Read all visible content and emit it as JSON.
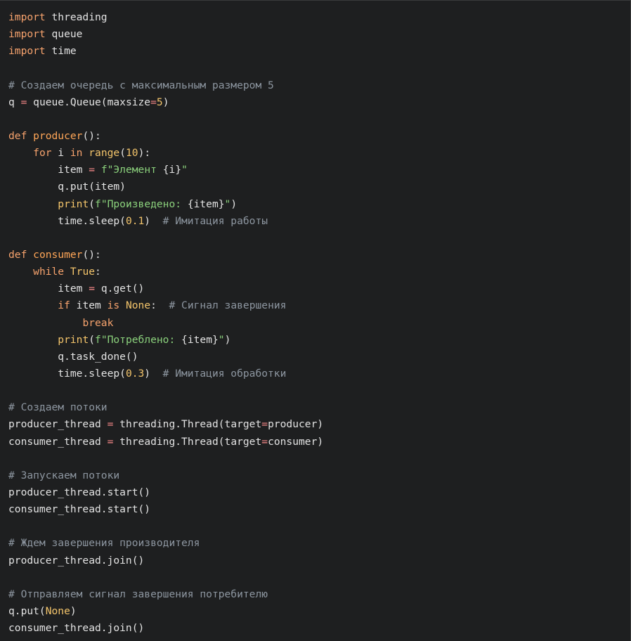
{
  "code": {
    "language": "python",
    "lines": [
      [
        {
          "t": "import",
          "c": "kw"
        },
        {
          "t": " threading",
          "c": "tx"
        }
      ],
      [
        {
          "t": "import",
          "c": "kw"
        },
        {
          "t": " queue",
          "c": "tx"
        }
      ],
      [
        {
          "t": "import",
          "c": "kw"
        },
        {
          "t": " time",
          "c": "tx"
        }
      ],
      [],
      [
        {
          "t": "# Создаем очередь с максимальным размером 5",
          "c": "cm"
        }
      ],
      [
        {
          "t": "q ",
          "c": "tx"
        },
        {
          "t": "=",
          "c": "op"
        },
        {
          "t": " queue.Queue(maxsize",
          "c": "tx"
        },
        {
          "t": "=",
          "c": "op"
        },
        {
          "t": "5",
          "c": "num"
        },
        {
          "t": ")",
          "c": "tx"
        }
      ],
      [],
      [
        {
          "t": "def",
          "c": "kw"
        },
        {
          "t": " ",
          "c": "tx"
        },
        {
          "t": "producer",
          "c": "fn"
        },
        {
          "t": "():",
          "c": "tx"
        }
      ],
      [
        {
          "t": "    ",
          "c": "tx"
        },
        {
          "t": "for",
          "c": "kw"
        },
        {
          "t": " i ",
          "c": "tx"
        },
        {
          "t": "in",
          "c": "kw"
        },
        {
          "t": " ",
          "c": "tx"
        },
        {
          "t": "range",
          "c": "bi"
        },
        {
          "t": "(",
          "c": "tx"
        },
        {
          "t": "10",
          "c": "num"
        },
        {
          "t": "):",
          "c": "tx"
        }
      ],
      [
        {
          "t": "        item ",
          "c": "tx"
        },
        {
          "t": "=",
          "c": "op"
        },
        {
          "t": " ",
          "c": "tx"
        },
        {
          "t": "f\"Элемент ",
          "c": "st"
        },
        {
          "t": "{i}",
          "c": "tx"
        },
        {
          "t": "\"",
          "c": "st"
        }
      ],
      [
        {
          "t": "        q.put(item)",
          "c": "tx"
        }
      ],
      [
        {
          "t": "        ",
          "c": "tx"
        },
        {
          "t": "print",
          "c": "bi"
        },
        {
          "t": "(",
          "c": "tx"
        },
        {
          "t": "f\"Произведено: ",
          "c": "st"
        },
        {
          "t": "{item}",
          "c": "tx"
        },
        {
          "t": "\"",
          "c": "st"
        },
        {
          "t": ")",
          "c": "tx"
        }
      ],
      [
        {
          "t": "        time.sleep(",
          "c": "tx"
        },
        {
          "t": "0.1",
          "c": "num"
        },
        {
          "t": ")  ",
          "c": "tx"
        },
        {
          "t": "# Имитация работы",
          "c": "cm"
        }
      ],
      [],
      [
        {
          "t": "def",
          "c": "kw"
        },
        {
          "t": " ",
          "c": "tx"
        },
        {
          "t": "consumer",
          "c": "fn"
        },
        {
          "t": "():",
          "c": "tx"
        }
      ],
      [
        {
          "t": "    ",
          "c": "tx"
        },
        {
          "t": "while",
          "c": "kw"
        },
        {
          "t": " ",
          "c": "tx"
        },
        {
          "t": "True",
          "c": "bi"
        },
        {
          "t": ":",
          "c": "tx"
        }
      ],
      [
        {
          "t": "        item ",
          "c": "tx"
        },
        {
          "t": "=",
          "c": "op"
        },
        {
          "t": " q.get()",
          "c": "tx"
        }
      ],
      [
        {
          "t": "        ",
          "c": "tx"
        },
        {
          "t": "if",
          "c": "kw"
        },
        {
          "t": " item ",
          "c": "tx"
        },
        {
          "t": "is",
          "c": "kw"
        },
        {
          "t": " ",
          "c": "tx"
        },
        {
          "t": "None",
          "c": "bi"
        },
        {
          "t": ":  ",
          "c": "tx"
        },
        {
          "t": "# Сигнал завершения",
          "c": "cm"
        }
      ],
      [
        {
          "t": "            ",
          "c": "tx"
        },
        {
          "t": "break",
          "c": "kw"
        }
      ],
      [
        {
          "t": "        ",
          "c": "tx"
        },
        {
          "t": "print",
          "c": "bi"
        },
        {
          "t": "(",
          "c": "tx"
        },
        {
          "t": "f\"Потреблено: ",
          "c": "st"
        },
        {
          "t": "{item}",
          "c": "tx"
        },
        {
          "t": "\"",
          "c": "st"
        },
        {
          "t": ")",
          "c": "tx"
        }
      ],
      [
        {
          "t": "        q.task_done()",
          "c": "tx"
        }
      ],
      [
        {
          "t": "        time.sleep(",
          "c": "tx"
        },
        {
          "t": "0.3",
          "c": "num"
        },
        {
          "t": ")  ",
          "c": "tx"
        },
        {
          "t": "# Имитация обработки",
          "c": "cm"
        }
      ],
      [],
      [
        {
          "t": "# Создаем потоки",
          "c": "cm"
        }
      ],
      [
        {
          "t": "producer_thread ",
          "c": "tx"
        },
        {
          "t": "=",
          "c": "op"
        },
        {
          "t": " threading.Thread(target",
          "c": "tx"
        },
        {
          "t": "=",
          "c": "op"
        },
        {
          "t": "producer)",
          "c": "tx"
        }
      ],
      [
        {
          "t": "consumer_thread ",
          "c": "tx"
        },
        {
          "t": "=",
          "c": "op"
        },
        {
          "t": " threading.Thread(target",
          "c": "tx"
        },
        {
          "t": "=",
          "c": "op"
        },
        {
          "t": "consumer)",
          "c": "tx"
        }
      ],
      [],
      [
        {
          "t": "# Запускаем потоки",
          "c": "cm"
        }
      ],
      [
        {
          "t": "producer_thread.start()",
          "c": "tx"
        }
      ],
      [
        {
          "t": "consumer_thread.start()",
          "c": "tx"
        }
      ],
      [],
      [
        {
          "t": "# Ждем завершения производителя",
          "c": "cm"
        }
      ],
      [
        {
          "t": "producer_thread.join()",
          "c": "tx"
        }
      ],
      [],
      [
        {
          "t": "# Отправляем сигнал завершения потребителю",
          "c": "cm"
        }
      ],
      [
        {
          "t": "q.put(",
          "c": "tx"
        },
        {
          "t": "None",
          "c": "bi"
        },
        {
          "t": ")",
          "c": "tx"
        }
      ],
      [
        {
          "t": "consumer_thread.join()",
          "c": "tx"
        }
      ]
    ]
  }
}
